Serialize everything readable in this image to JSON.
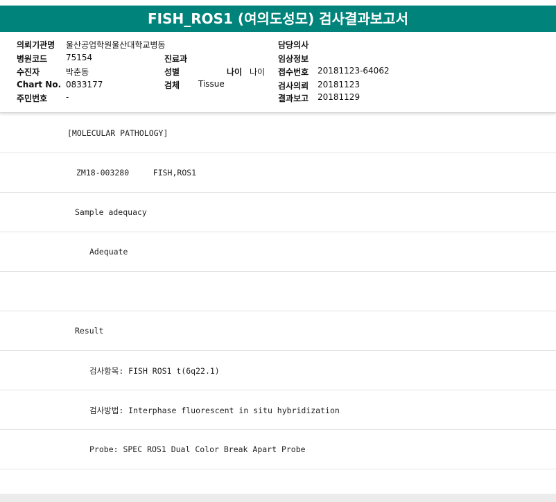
{
  "header": {
    "title": "FISH_ROS1 (여의도성모) 검사결과보고서"
  },
  "info": {
    "institution": {
      "label": "의뢰기관명",
      "value": "울산공업학원울산대학교병동"
    },
    "hospital_code": {
      "label": "병원코드",
      "value": "75154"
    },
    "patient": {
      "label": "수진자",
      "value": "박춘동"
    },
    "chart_no": {
      "label": "Chart No.",
      "value": "0833177"
    },
    "resident_no": {
      "label": "주민번호",
      "value": "-"
    },
    "department": {
      "label": "진료과",
      "value": ""
    },
    "sex": {
      "label": "성별",
      "value": ""
    },
    "age": {
      "label": "나이",
      "value": "나이"
    },
    "specimen": {
      "label": "검체",
      "value": "Tissue"
    },
    "doctor": {
      "label": "담당의사",
      "value": ""
    },
    "clinical_info": {
      "label": "임상정보",
      "value": ""
    },
    "receipt_no": {
      "label": "접수번호",
      "value": "20181123-64062"
    },
    "request_date": {
      "label": "검사의뢰",
      "value": "20181123"
    },
    "report_date": {
      "label": "결과보고",
      "value": "20181129"
    }
  },
  "report": {
    "lines": [
      "[MOLECULAR PATHOLOGY]",
      "ZM18-003280     FISH,ROS1",
      "Sample adequacy",
      "Adequate",
      "",
      "Result",
      "검사항목: FISH ROS1 t(6q22.1)",
      "검사방법: Interphase fluorescent in situ hybridization",
      "Probe: SPEC ROS1 Dual Color Break Apart Probe"
    ]
  }
}
